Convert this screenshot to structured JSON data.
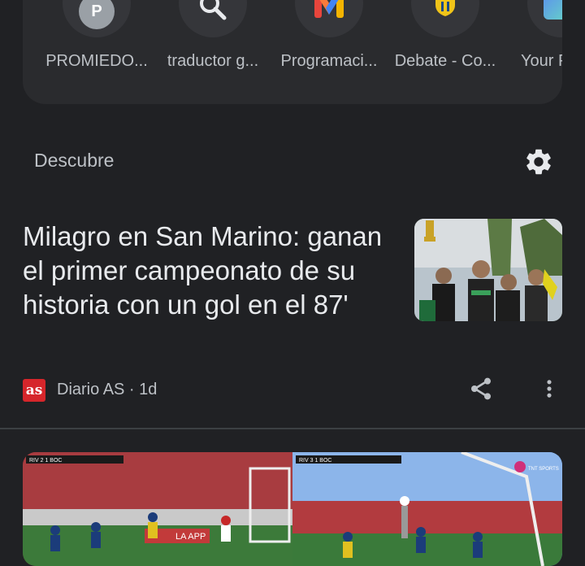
{
  "shortcuts": [
    {
      "label": "PROMIEDO...",
      "icon": "p-letter-icon",
      "letter": "P"
    },
    {
      "label": "traductor g...",
      "icon": "search-icon"
    },
    {
      "label": "Programaci...",
      "icon": "m-logo-icon"
    },
    {
      "label": "Debate - Co...",
      "icon": "lpf-shield-icon"
    },
    {
      "label": "Your P",
      "icon": "app-icon"
    }
  ],
  "discover": {
    "title": "Descubre",
    "settings_icon": "gear-icon"
  },
  "article": {
    "headline": "Milagro en San Marino: ganan el primer campeonato de su historia con un gol en el 87'",
    "source_logo_text": "as",
    "source": "Diario AS · 1d"
  },
  "video": {
    "left_score_text": "RIV 2 1 BOC",
    "right_score_text": "RIV 3 1 BOC",
    "banner_text": "LA APP",
    "tnt_text": "TNT SPORTS"
  },
  "colors": {
    "background": "#202124",
    "card": "#2a2b2e",
    "as_red": "#d6262b"
  }
}
